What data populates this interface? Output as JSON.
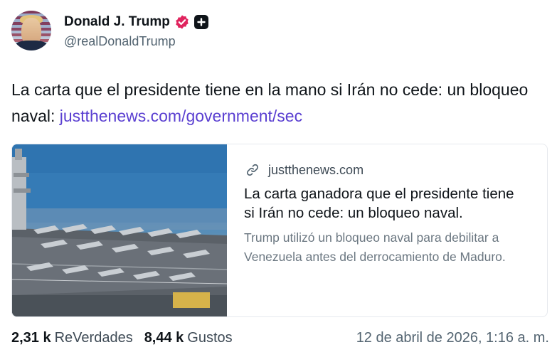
{
  "author": {
    "name": "Donald J. Trump",
    "handle": "@realDonaldTrump",
    "verified_color": "#e0245e"
  },
  "post": {
    "text": "La carta que el presidente tiene en la mano si Irán no cede: un bloqueo naval: ",
    "link_text": "justthenews.com/government/sec",
    "link_color": "#5a3fd1"
  },
  "card": {
    "image_icon": "aircraft-carrier-photo",
    "domain": "justthenews.com",
    "title": "La carta ganadora que el presidente tiene si Irán no cede: un bloqueo naval.",
    "description": "Trump utilizó un bloqueo naval para debilitar a Venezuela antes del derrocamiento de Maduro."
  },
  "stats": {
    "retruths_count": "2,31 k",
    "retruths_label": "ReVerdades",
    "likes_count": "8,44 k",
    "likes_label": "Gustos"
  },
  "timestamp": "12 de abril de 2026, 1:16 a. m."
}
